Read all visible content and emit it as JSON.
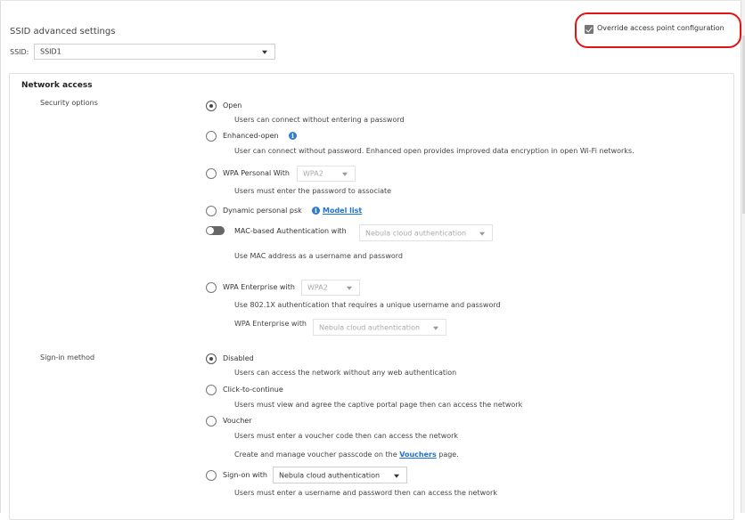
{
  "header": {
    "title": "SSID advanced settings",
    "ssid_label": "SSID:",
    "ssid_value": "SSID1",
    "override_label": "Override access point configuration",
    "override_checked": true
  },
  "network_access": {
    "title": "Network access",
    "security_label": "Security options",
    "security": {
      "open": {
        "label": "Open",
        "desc": "Users can connect without entering a password",
        "selected": true
      },
      "enhanced_open": {
        "label": "Enhanced-open",
        "desc": "User can connect without password. Enhanced open provides improved data encryption in open Wi-Fi networks."
      },
      "wpa_personal": {
        "label": "WPA Personal With",
        "select_value": "WPA2",
        "desc": "Users must enter the password to associate"
      },
      "dppsk": {
        "label": "Dynamic personal psk",
        "link": "Model list"
      },
      "mac_auth": {
        "label": "MAC-based Authentication with",
        "select_value": "Nebula cloud authentication",
        "desc": "Use MAC address as a username and password"
      },
      "wpa_enterprise": {
        "label": "WPA Enterprise with",
        "select_value": "WPA2",
        "desc": "Use 802.1X authentication that requires a unique username and password",
        "sub_label": "WPA Enterprise with",
        "sub_select_value": "Nebula cloud authentication"
      }
    },
    "signin_label": "Sign-in method",
    "signin": {
      "disabled": {
        "label": "Disabled",
        "desc": "Users can access the network without any web authentication",
        "selected": true
      },
      "click": {
        "label": "Click-to-continue",
        "desc": "Users must view and agree the captive portal page then can access the network"
      },
      "voucher": {
        "label": "Voucher",
        "desc": "Users must enter a voucher code then can access the network",
        "note_prefix": "Create and manage voucher passcode on the",
        "note_link": "Vouchers",
        "note_suffix": "page."
      },
      "signon": {
        "label": "Sign-on with",
        "select_value": "Nebula cloud authentication",
        "desc": "Users must enter a username and password then can access the network"
      }
    }
  },
  "colors": {
    "accent_link": "#1a73d1",
    "highlight": "#e01414",
    "info": "#2f7cd6"
  },
  "icons": {
    "info": "info-icon",
    "checkbox": "check-icon",
    "dropdown": "chevron-down-icon"
  }
}
